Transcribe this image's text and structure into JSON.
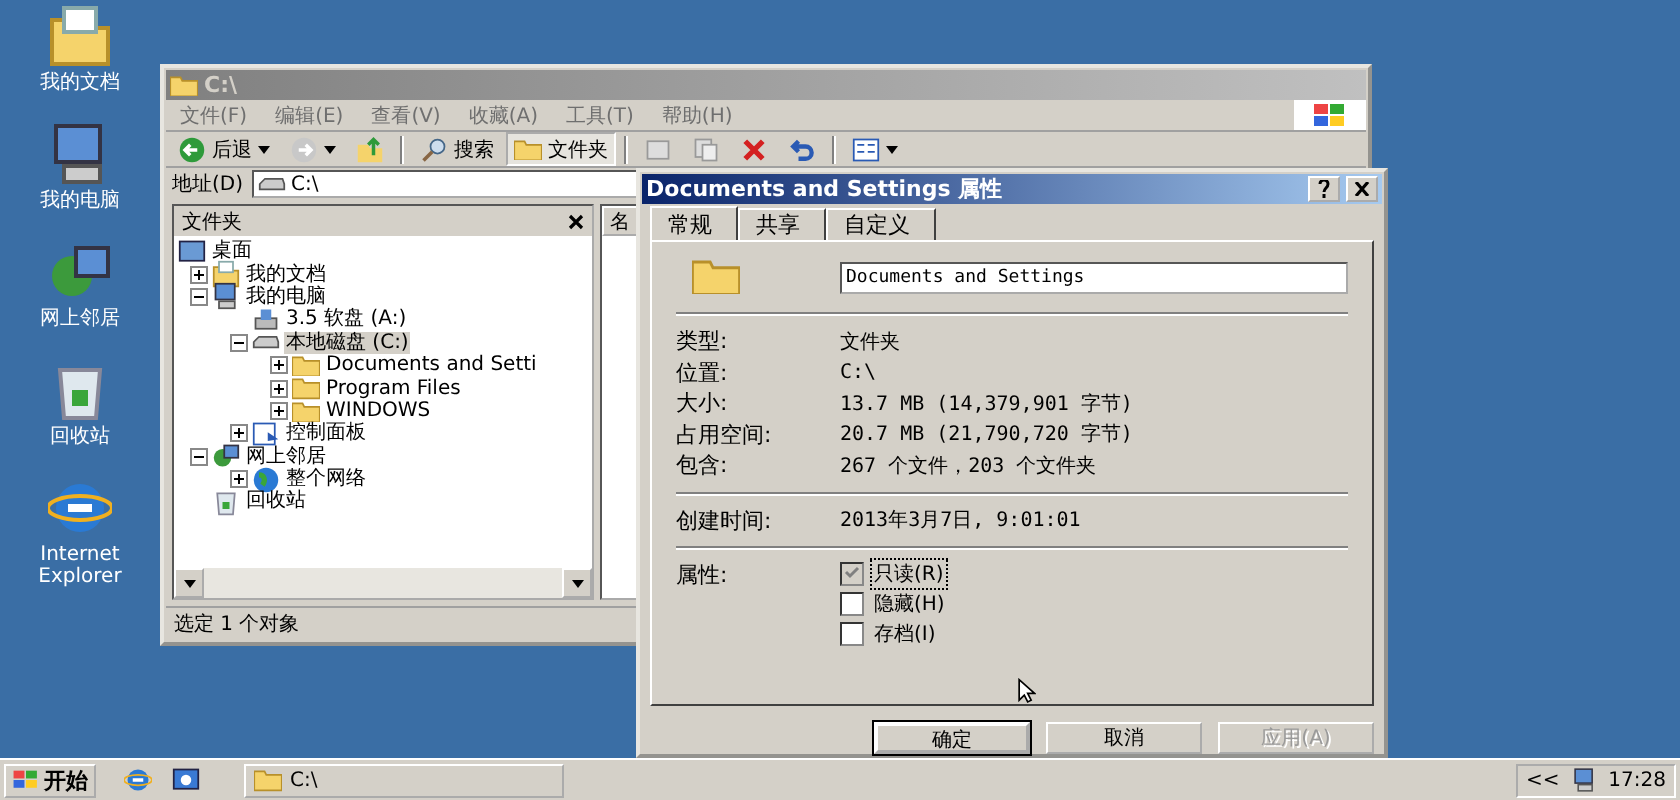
{
  "desktop_icons": [
    {
      "kind": "documents",
      "label": "我的文档"
    },
    {
      "kind": "computer",
      "label": "我的电脑"
    },
    {
      "kind": "network",
      "label": "网上邻居"
    },
    {
      "kind": "recycle",
      "label": "回收站"
    },
    {
      "kind": "browser",
      "label": "Internet Explorer"
    }
  ],
  "explorer": {
    "title": "C:\\",
    "active": false,
    "menu": [
      "文件(F)",
      "编辑(E)",
      "查看(V)",
      "收藏(A)",
      "工具(T)",
      "帮助(H)"
    ],
    "toolbar": [
      {
        "kind": "back",
        "label": "后退"
      },
      {
        "kind": "forward"
      },
      {
        "kind": "up"
      },
      {
        "kind": "search",
        "label": "搜索"
      },
      {
        "kind": "folders",
        "label": "文件夹",
        "selected": true
      },
      {
        "kind": "move"
      },
      {
        "kind": "copy"
      },
      {
        "kind": "delete"
      },
      {
        "kind": "undo"
      },
      {
        "kind": "views"
      }
    ],
    "address": {
      "label": "地址(D)",
      "value": "C:\\"
    },
    "folders_pane": {
      "title": "文件夹",
      "tree": [
        {
          "kind": "desktop",
          "label": "桌面",
          "selected": false,
          "children": [
            {
              "kind": "documents",
              "label": "我的文档",
              "expanded": false,
              "selected": false
            },
            {
              "kind": "computer",
              "label": "我的电脑",
              "expanded": true,
              "selected": false,
              "children": [
                {
                  "kind": "floppy",
                  "label": "3.5 软盘 (A:)",
                  "selected": false
                },
                {
                  "kind": "drive",
                  "label": "本地磁盘 (C:)",
                  "expanded": true,
                  "selected": true,
                  "children": [
                    {
                      "kind": "folder",
                      "label": "Documents and Setti",
                      "expanded": false,
                      "selected": false
                    },
                    {
                      "kind": "folder",
                      "label": "Program Files",
                      "expanded": false,
                      "selected": false
                    },
                    {
                      "kind": "folder",
                      "label": "WINDOWS",
                      "expanded": false,
                      "selected": false
                    }
                  ]
                },
                {
                  "kind": "control",
                  "label": "控制面板",
                  "expanded": false,
                  "selected": false
                }
              ]
            },
            {
              "kind": "network",
              "label": "网上邻居",
              "expanded": true,
              "selected": false,
              "children": [
                {
                  "kind": "globe",
                  "label": "整个网络",
                  "expanded": false,
                  "selected": false
                }
              ]
            },
            {
              "kind": "recycle",
              "label": "回收站",
              "selected": false
            }
          ]
        }
      ]
    },
    "right_pane": {
      "column_1": "名"
    },
    "status": "选定 1 个对象"
  },
  "dialog": {
    "title": "Documents and Settings 属性",
    "active": true,
    "tabs": [
      {
        "label": "常规",
        "selected": true
      },
      {
        "label": "共享",
        "selected": false
      },
      {
        "label": "自定义",
        "selected": false
      }
    ],
    "name": "Documents and Settings",
    "info": [
      {
        "label": "类型:",
        "value": "文件夹"
      },
      {
        "label": "位置:",
        "value": "C:\\"
      },
      {
        "label": "大小:",
        "value": "13.7 MB (14,379,901 字节)"
      },
      {
        "label": "占用空间:",
        "value": "20.7 MB (21,790,720 字节)"
      },
      {
        "label": "包含:",
        "value": "267 个文件，203 个文件夹"
      }
    ],
    "created": {
      "label": "创建时间:",
      "value": "2013年3月7日, 9:01:01"
    },
    "attributes_label": "属性:",
    "attributes": [
      {
        "label": "只读(R)",
        "checked": true,
        "disabled": true,
        "focused": true
      },
      {
        "label": "隐藏(H)",
        "checked": false,
        "disabled": false,
        "focused": false
      },
      {
        "label": "存档(I)",
        "checked": false,
        "disabled": false,
        "focused": false
      }
    ],
    "buttons": [
      {
        "label": "确定",
        "default": true,
        "disabled": false
      },
      {
        "label": "取消",
        "default": false,
        "disabled": false
      },
      {
        "label": "应用(A)",
        "default": false,
        "disabled": true
      }
    ]
  },
  "taskbar": {
    "start": "开始",
    "quick_launch": [
      {
        "kind": "browser"
      },
      {
        "kind": "desktop"
      }
    ],
    "tasks": [
      {
        "label": "C:\\",
        "selected": false
      }
    ],
    "tray_toggle": "<<",
    "clock": "17:28"
  }
}
